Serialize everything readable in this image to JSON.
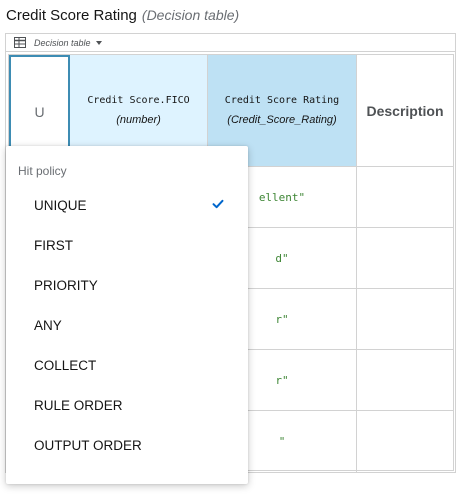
{
  "header": {
    "name": "Credit Score Rating",
    "type": "(Decision table)"
  },
  "toolbar": {
    "label": "Decision table"
  },
  "table": {
    "hit_policy_abbrev": "U",
    "input_column": {
      "name": "Credit Score.FICO",
      "type": "(number)"
    },
    "output_column": {
      "name": "Credit Score Rating",
      "type": "(Credit_Score_Rating)"
    },
    "annotation_column": {
      "name": "Description"
    },
    "rows": [
      {
        "output": "ellent\""
      },
      {
        "output": "d\""
      },
      {
        "output": "r\""
      },
      {
        "output": "r\""
      },
      {
        "output": "\""
      }
    ]
  },
  "hit_policy_menu": {
    "header": "Hit policy",
    "selected": "UNIQUE",
    "items": [
      {
        "label": "UNIQUE"
      },
      {
        "label": "FIRST"
      },
      {
        "label": "PRIORITY"
      },
      {
        "label": "ANY"
      },
      {
        "label": "COLLECT"
      },
      {
        "label": "RULE ORDER"
      },
      {
        "label": "OUTPUT ORDER"
      }
    ]
  },
  "colors": {
    "accent": "#0066cc",
    "selected_border": "#3d8cb3",
    "input_header_bg": "#def3ff",
    "output_header_bg": "#bee1f4",
    "string_literal": "#3e8635"
  },
  "icons": {
    "toolbar": "table-icon",
    "toolbar_dropdown": "caret-down-icon",
    "selected_item": "check-icon"
  }
}
